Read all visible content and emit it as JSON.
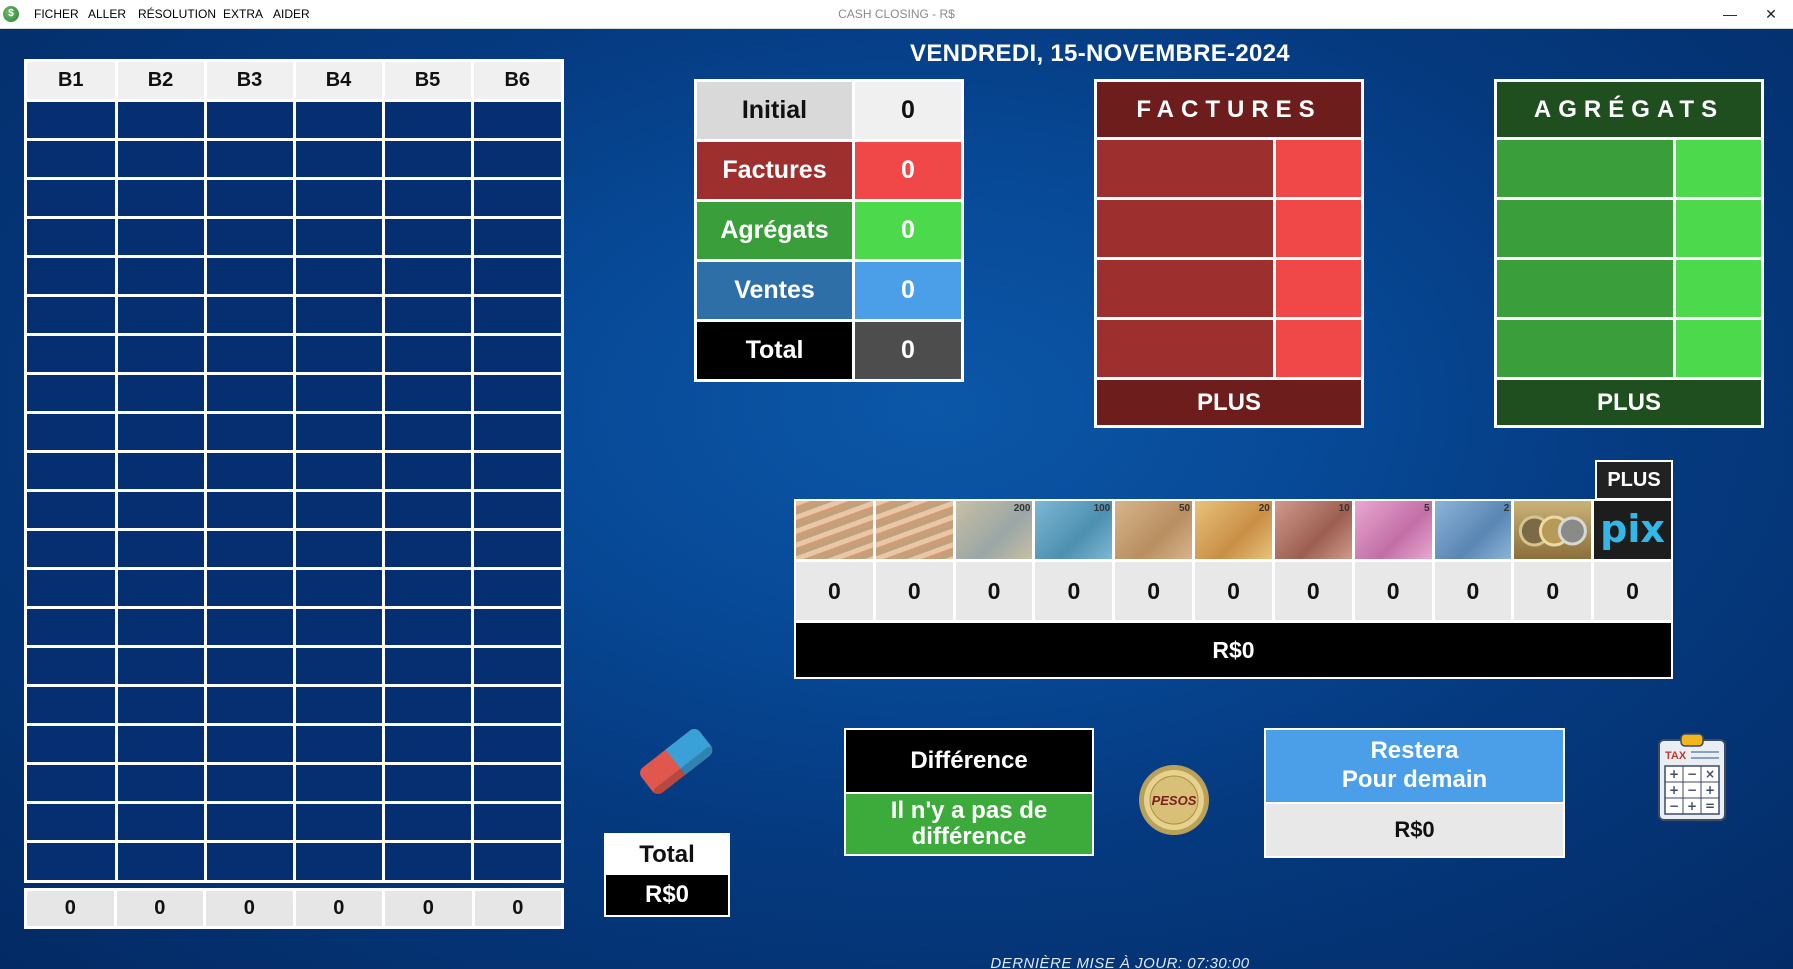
{
  "window": {
    "title": "CASH CLOSING - R$",
    "menu": [
      "FICHER",
      "ALLER",
      "RÉSOLUTION",
      "EXTRA",
      "AIDER"
    ],
    "minimize": "—",
    "close": "✕"
  },
  "date": "VENDREDI, 15-NOVEMBRE-2024",
  "b_grid": {
    "headers": [
      "B1",
      "B2",
      "B3",
      "B4",
      "B5",
      "B6"
    ],
    "row_count": 20,
    "totals": [
      "0",
      "0",
      "0",
      "0",
      "0",
      "0"
    ]
  },
  "summary": {
    "rows": [
      {
        "label": "Initial",
        "value": "0",
        "label_bg": "#d9d9d9",
        "label_color": "#111111",
        "value_bg": "#f0f0f0",
        "value_color": "#111111"
      },
      {
        "label": "Factures",
        "value": "0",
        "label_bg": "#9e2f2f",
        "label_color": "#ffffff",
        "value_bg": "#f04848",
        "value_color": "#ffffff"
      },
      {
        "label": "Agrégats",
        "value": "0",
        "label_bg": "#3a9e3a",
        "label_color": "#ffffff",
        "value_bg": "#4cd94c",
        "value_color": "#ffffff"
      },
      {
        "label": "Ventes",
        "value": "0",
        "label_bg": "#2f6fa8",
        "label_color": "#ffffff",
        "value_bg": "#4a9fe8",
        "value_color": "#ffffff"
      },
      {
        "label": "Total",
        "value": "0",
        "label_bg": "#000000",
        "label_color": "#ffffff",
        "value_bg": "#4d4d4d",
        "value_color": "#ffffff"
      }
    ]
  },
  "factures": {
    "title": "FACTURES",
    "more": "PLUS",
    "row_count": 4,
    "colors": {
      "head": "#6e1d1d",
      "left": "#9e2f2f",
      "right": "#f04848",
      "plus": "#6e1d1d"
    }
  },
  "agregats": {
    "title": "AGRÉGATS",
    "more": "PLUS",
    "row_count": 4,
    "colors": {
      "head": "#1f4f1f",
      "left": "#3a9e3a",
      "right": "#4cd94c",
      "plus": "#1f4f1f"
    }
  },
  "money": {
    "more": "PLUS",
    "denominations": [
      {
        "icon": "banknote-bundle-icon",
        "label": ""
      },
      {
        "icon": "banknote-bundle-icon",
        "label": ""
      },
      {
        "icon": "banknote-200-icon",
        "label": "200"
      },
      {
        "icon": "banknote-100-icon",
        "label": "100"
      },
      {
        "icon": "banknote-50-icon",
        "label": "50"
      },
      {
        "icon": "banknote-20-icon",
        "label": "20"
      },
      {
        "icon": "banknote-10-icon",
        "label": "10"
      },
      {
        "icon": "banknote-5-icon",
        "label": "5"
      },
      {
        "icon": "banknote-2-icon",
        "label": "2"
      },
      {
        "icon": "coins-icon",
        "label": ""
      },
      {
        "icon": "pix-icon",
        "label": "pix"
      }
    ],
    "counts": [
      "0",
      "0",
      "0",
      "0",
      "0",
      "0",
      "0",
      "0",
      "0",
      "0",
      "0"
    ],
    "total": "R$0"
  },
  "total_box": {
    "label": "Total",
    "value": "R$0"
  },
  "difference": {
    "label": "Différence",
    "value": "Il n'y a pas de différence"
  },
  "pesos_coin": {
    "text": "PESOS"
  },
  "restera": {
    "line1": "Restera",
    "line2": "Pour demain",
    "value": "R$0"
  },
  "tax_icon": {
    "text": "TAX"
  },
  "footer": "DERNIÈRE MISE À JOUR: 07:30:00"
}
